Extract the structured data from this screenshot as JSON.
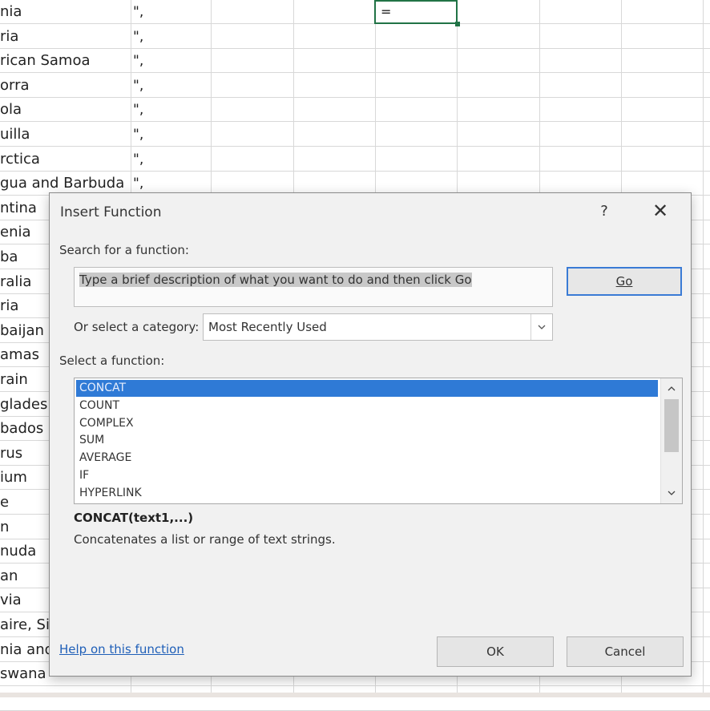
{
  "sheet": {
    "colA": [
      "nia",
      "ria",
      "rican Samoa",
      "orra",
      "ola",
      "uilla",
      "rctica",
      "gua and Barbuda",
      "ntina",
      "enia",
      "ba",
      "ralia",
      "ria",
      "baijan",
      "amas",
      "rain",
      "gladesh",
      "bados",
      "rus",
      "ium",
      "e",
      "n",
      "nuda",
      "an",
      "via",
      "aire, Sir",
      "nia and",
      "swana"
    ],
    "colB": [
      "\",",
      "\",",
      "\",",
      "\",",
      "\",",
      "\",",
      "\",",
      "\","
    ],
    "active_cell_value": "="
  },
  "dialog": {
    "title": "Insert Function",
    "help_glyph": "?",
    "close_glyph": "✕",
    "search_label": "Search for a function:",
    "search_value": "Type a brief description of what you want to do and then click Go",
    "go_label": "Go",
    "category_label": "Or select a category:",
    "category_value": "Most Recently Used",
    "select_label": "Select a function:",
    "functions": [
      "CONCAT",
      "COUNT",
      "COMPLEX",
      "SUM",
      "AVERAGE",
      "IF",
      "HYPERLINK"
    ],
    "selected_function": "CONCAT",
    "signature": "CONCAT(text1,...)",
    "description": "Concatenates a list or range of text strings.",
    "help_link": "Help on this function",
    "ok_label": "OK",
    "cancel_label": "Cancel"
  },
  "icons": {
    "dropdown": "chevron-down-icon",
    "scroll_up": "chevron-up-icon",
    "scroll_down": "chevron-down-icon"
  },
  "colors": {
    "selection": "#2f7ad6",
    "go_border": "#3a7bd5",
    "active_cell_border": "#217346",
    "link": "#1f5fb8"
  }
}
